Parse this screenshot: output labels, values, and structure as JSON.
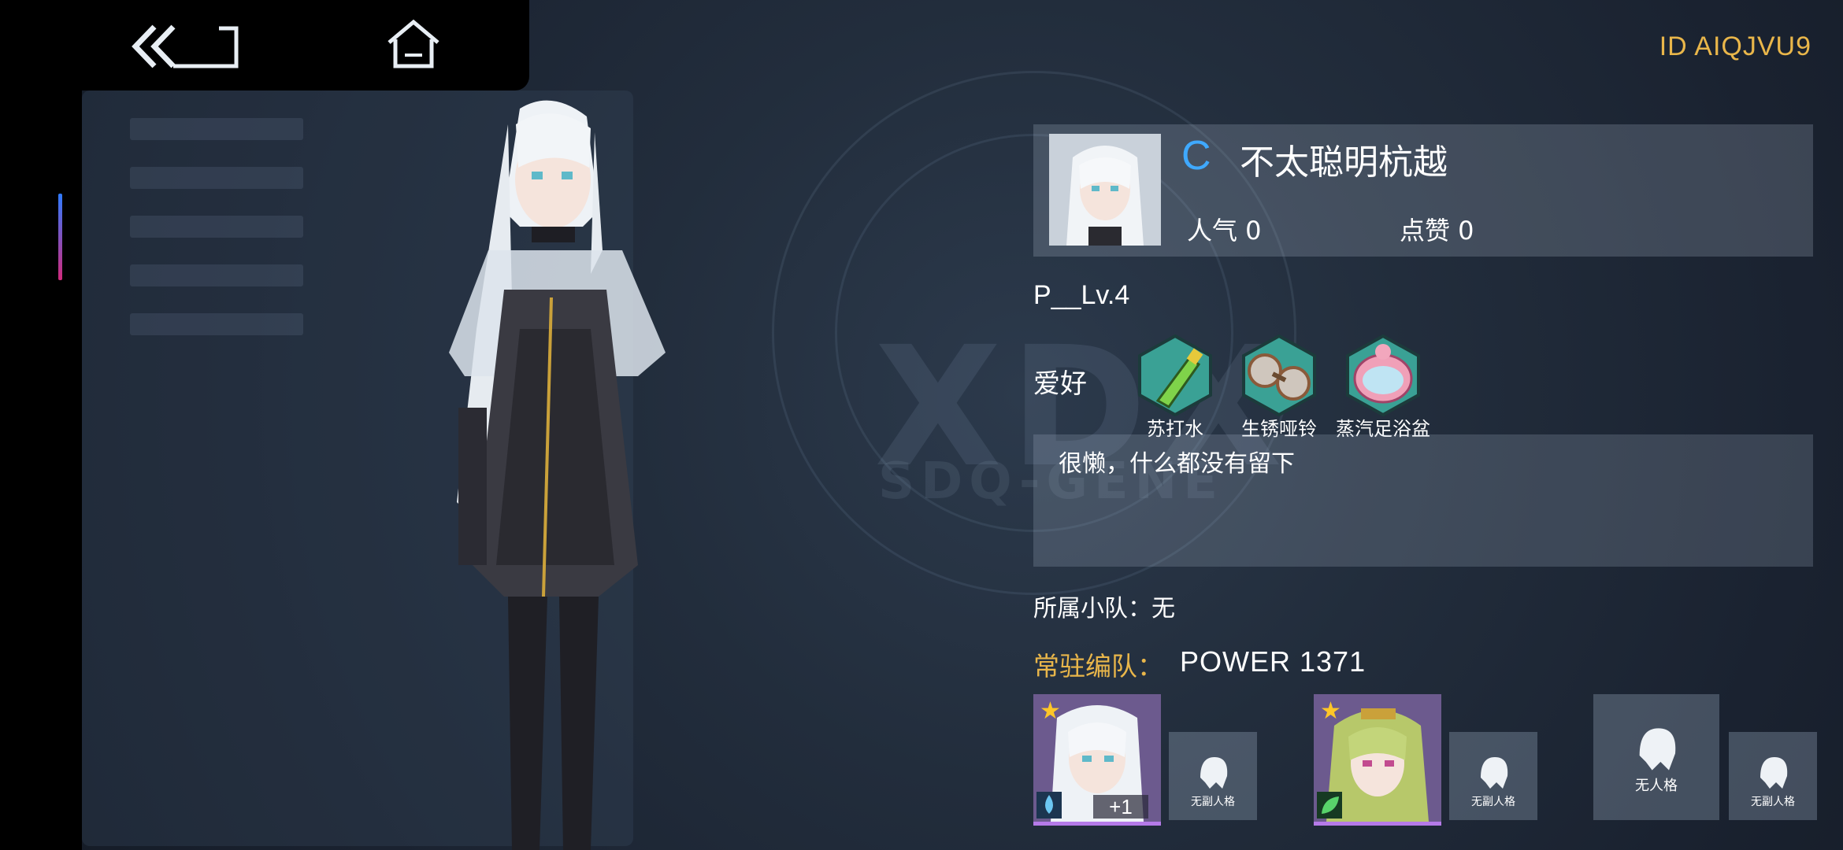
{
  "header": {
    "player_id": "ID AIQJVU9"
  },
  "profile": {
    "rank": "C",
    "name": "不太聪明杭越",
    "popularity": "人气 0",
    "likes": "点赞 0",
    "level": "P__Lv.4"
  },
  "hobbies": {
    "label": "爱好",
    "items": [
      {
        "name": "苏打水",
        "icon": "soda-bottle-icon"
      },
      {
        "name": "生锈哑铃",
        "icon": "rusty-dumbbell-icon"
      },
      {
        "name": "蒸汽足浴盆",
        "icon": "foot-bath-icon"
      }
    ]
  },
  "signature": "很懒，什么都没有留下",
  "squad": {
    "text": "所属小队：无"
  },
  "formation": {
    "label": "常驻编队：",
    "power": "POWER   1371",
    "members": [
      {
        "plus": "+1",
        "element": "water-drop-icon"
      },
      {
        "plus": "",
        "element": "leaf-icon"
      }
    ],
    "empty_label": "无副人格",
    "empty_main_label": "无人格"
  },
  "colors": {
    "accent": "#e9b64a",
    "rank": "#3fa9ff",
    "background": "#1f2937"
  }
}
